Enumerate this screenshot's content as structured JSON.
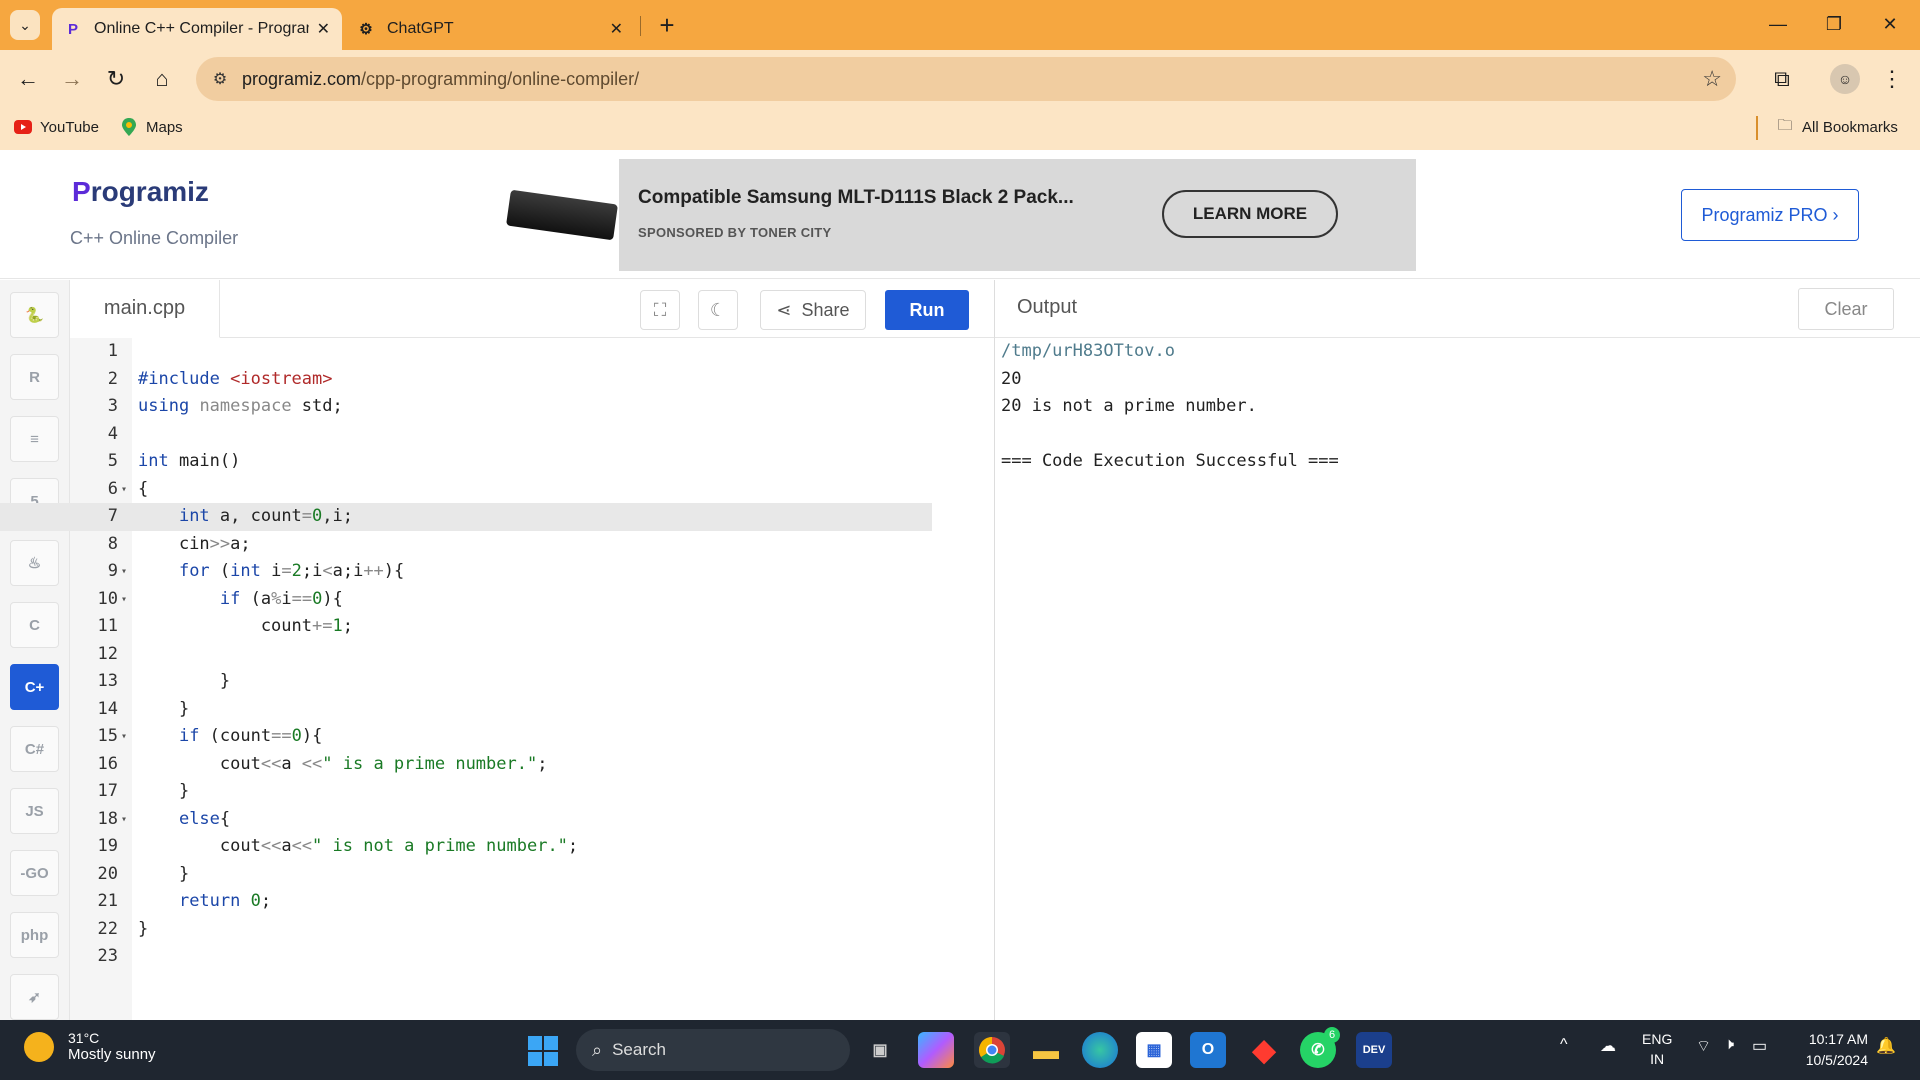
{
  "browser": {
    "tabs": [
      {
        "title": "Online C++ Compiler - Program",
        "favicon": "programiz-icon",
        "active": true
      },
      {
        "title": "ChatGPT",
        "favicon": "chatgpt-icon",
        "active": false
      }
    ],
    "url_domain": "programiz.com",
    "url_path": "/cpp-programming/online-compiler/",
    "bookmarks": [
      {
        "label": "YouTube",
        "icon": "youtube-icon"
      },
      {
        "label": "Maps",
        "icon": "maps-pin-icon"
      }
    ],
    "all_bookmarks_label": "All Bookmarks",
    "accent_color": "#F6A740"
  },
  "header": {
    "logo_text": "rogramiz",
    "logo_p": "P",
    "subtitle": "C++ Online Compiler",
    "pro_button": "Programiz PRO ›",
    "ad": {
      "title": "Compatible Samsung MLT-D111S Black 2 Pack...",
      "sponsor": "SPONSORED BY TONER CITY",
      "cta": "LEARN MORE"
    }
  },
  "rail": {
    "languages": [
      {
        "name": "python",
        "glyph": "🐍"
      },
      {
        "name": "r",
        "glyph": "R"
      },
      {
        "name": "sql",
        "glyph": "≡"
      },
      {
        "name": "html",
        "glyph": "5"
      },
      {
        "name": "java",
        "glyph": "♨"
      },
      {
        "name": "c",
        "glyph": "C"
      },
      {
        "name": "cpp",
        "glyph": "C+",
        "active": true
      },
      {
        "name": "csharp",
        "glyph": "C#"
      },
      {
        "name": "javascript",
        "glyph": "JS"
      },
      {
        "name": "go",
        "glyph": "-GO"
      },
      {
        "name": "php",
        "glyph": "php"
      },
      {
        "name": "swift",
        "glyph": "➶"
      }
    ]
  },
  "editor": {
    "filename": "main.cpp",
    "share_label": "Share",
    "run_label": "Run",
    "active_line": 7,
    "lines": [
      {
        "n": "1",
        "fold": false,
        "html": ""
      },
      {
        "n": "2",
        "fold": false,
        "html": "<span class='pp'>#include</span> <span class='inc'>&lt;iostream&gt;</span>"
      },
      {
        "n": "3",
        "fold": false,
        "html": "<span class='k'>using</span> <span class='op'>namespace</span> std;"
      },
      {
        "n": "4",
        "fold": false,
        "html": ""
      },
      {
        "n": "5",
        "fold": false,
        "html": "<span class='k'>int</span> main()"
      },
      {
        "n": "6",
        "fold": true,
        "html": "{"
      },
      {
        "n": "7",
        "fold": false,
        "html": "    <span class='k'>int</span> a, count<span class='op'>=</span><span class='num'>0</span>,i;"
      },
      {
        "n": "8",
        "fold": false,
        "html": "    cin<span class='op'>&gt;&gt;</span>a;"
      },
      {
        "n": "9",
        "fold": true,
        "html": "    <span class='k'>for</span> (<span class='k'>int</span> i<span class='op'>=</span><span class='num'>2</span>;i<span class='op'>&lt;</span>a;i<span class='op'>++</span>){"
      },
      {
        "n": "10",
        "fold": true,
        "html": "        <span class='k'>if</span> (a<span class='op'>%</span>i<span class='op'>==</span><span class='num'>0</span>){"
      },
      {
        "n": "11",
        "fold": false,
        "html": "            count<span class='op'>+=</span><span class='num'>1</span>;"
      },
      {
        "n": "12",
        "fold": false,
        "html": ""
      },
      {
        "n": "13",
        "fold": false,
        "html": "        }"
      },
      {
        "n": "14",
        "fold": false,
        "html": "    }"
      },
      {
        "n": "15",
        "fold": true,
        "html": "    <span class='k'>if</span> (count<span class='op'>==</span><span class='num'>0</span>){"
      },
      {
        "n": "16",
        "fold": false,
        "html": "        cout<span class='op'>&lt;&lt;</span>a <span class='op'>&lt;&lt;</span><span class='str'>\" is a prime number.\"</span>;"
      },
      {
        "n": "17",
        "fold": false,
        "html": "    }"
      },
      {
        "n": "18",
        "fold": true,
        "html": "    <span class='k'>else</span>{"
      },
      {
        "n": "19",
        "fold": false,
        "html": "        cout<span class='op'>&lt;&lt;</span>a<span class='op'>&lt;&lt;</span><span class='str'>\" is not a prime number.\"</span>;"
      },
      {
        "n": "20",
        "fold": false,
        "html": "    }"
      },
      {
        "n": "21",
        "fold": false,
        "html": "    <span class='k'>return</span> <span class='num'>0</span>;"
      },
      {
        "n": "22",
        "fold": false,
        "html": "}"
      },
      {
        "n": "23",
        "fold": false,
        "html": ""
      }
    ]
  },
  "output": {
    "title": "Output",
    "clear_label": "Clear",
    "lines": [
      {
        "text": "/tmp/urH83OTtov.o",
        "kind": "path"
      },
      {
        "text": "20",
        "kind": "text"
      },
      {
        "text": "20 is not a prime number.",
        "kind": "text"
      },
      {
        "text": "",
        "kind": "text"
      },
      {
        "text": "=== Code Execution Successful ===",
        "kind": "text"
      }
    ]
  },
  "taskbar": {
    "weather_temp": "31°C",
    "weather_cond": "Mostly sunny",
    "search_placeholder": "Search",
    "lang_top": "ENG",
    "lang_bottom": "IN",
    "time": "10:17 AM",
    "date": "10/5/2024",
    "whatsapp_badge": "6",
    "devcpp_label": "DEV"
  }
}
